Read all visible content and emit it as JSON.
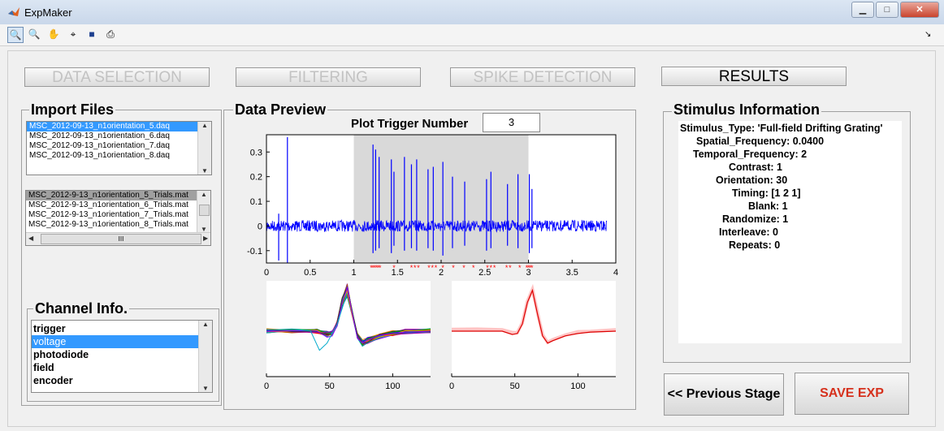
{
  "window": {
    "title": "ExpMaker",
    "minimize": "▁",
    "maximize": "□",
    "close": "✕"
  },
  "toolbar": {
    "icons": [
      "zoom-in-icon",
      "zoom-out-icon",
      "pan-icon",
      "data-cursor-icon",
      "save-icon",
      "print-icon"
    ],
    "corner": "↘"
  },
  "stages": {
    "data_selection": "DATA SELECTION",
    "filtering": "FILTERING",
    "spike_detection": "SPIKE DETECTION",
    "results": "RESULTS"
  },
  "import": {
    "title": "Import Files",
    "daq_files": [
      "MSC_2012-09-13_n1orientation_5.daq",
      "MSC_2012-09-13_n1orientation_6.daq",
      "MSC_2012-09-13_n1orientation_7.daq",
      "MSC_2012-09-13_n1orientation_8.daq"
    ],
    "trial_files": [
      "MSC_2012-9-13_n1orientation_5_Trials.mat",
      "MSC_2012-9-13_n1orientation_6_Trials.mat",
      "MSC_2012-9-13_n1orientation_7_Trials.mat",
      "MSC_2012-9-13_n1orientation_8_Trials.mat"
    ],
    "hscroll_thumb": "III"
  },
  "channel": {
    "title": "Channel Info.",
    "items": [
      "trigger",
      "voltage",
      "photodiode",
      "field",
      "encoder"
    ],
    "selected": "voltage"
  },
  "preview": {
    "title": "Data Preview",
    "trigger_label": "Plot Trigger Number",
    "trigger_value": "3"
  },
  "stimulus": {
    "title": "Stimulus Information",
    "lines": [
      "Stimulus_Type: 'Full-field Drifting Grating'",
      "Spatial_Frequency: 0.0400",
      "Temporal_Frequency: 2",
      "Contrast: 1",
      "Orientation: 30",
      "Timing: [1 2 1]",
      "Blank: 1",
      "Randomize: 1",
      "Interleave: 0",
      "Repeats: 0"
    ]
  },
  "buttons": {
    "previous": "<< Previous Stage",
    "save": "SAVE EXP"
  },
  "colors": {
    "trace": "#0000ff",
    "spike_marker": "#ff0000",
    "highlight": "#d9d9d9",
    "selection": "#3399ff",
    "save_text": "#d6301c"
  },
  "chart_data": [
    {
      "type": "line",
      "title": "",
      "xlim": [
        0,
        4
      ],
      "ylim": [
        -0.15,
        0.37
      ],
      "x_ticks": [
        "0",
        "0.5",
        "1",
        "1.5",
        "2",
        "2.5",
        "3",
        "3.5",
        "4"
      ],
      "y_ticks": [
        "0.3",
        "0.2",
        "0.1",
        "0",
        "-0.1"
      ],
      "highlight_range": [
        1,
        3
      ],
      "spikes": [
        {
          "x": 0.24,
          "y": 0.36,
          "ymin": -0.15
        },
        {
          "x": 0.14,
          "y": 0.05,
          "ymin": -0.14
        },
        {
          "x": 1.22,
          "y": 0.33,
          "ymin": -0.11
        },
        {
          "x": 1.25,
          "y": 0.31,
          "ymin": -0.1
        },
        {
          "x": 1.29,
          "y": 0.28,
          "ymin": -0.09
        },
        {
          "x": 1.43,
          "y": 0.27,
          "ymin": -0.11
        },
        {
          "x": 1.46,
          "y": 0.22,
          "ymin": -0.08
        },
        {
          "x": 1.58,
          "y": 0.28,
          "ymin": -0.1
        },
        {
          "x": 1.66,
          "y": 0.25,
          "ymin": -0.09
        },
        {
          "x": 1.72,
          "y": 0.27,
          "ymin": -0.1
        },
        {
          "x": 1.85,
          "y": 0.23,
          "ymin": -0.09
        },
        {
          "x": 1.91,
          "y": 0.24,
          "ymin": -0.1
        },
        {
          "x": 2.02,
          "y": 0.26,
          "ymin": -0.12
        },
        {
          "x": 2.13,
          "y": 0.2,
          "ymin": -0.09
        },
        {
          "x": 2.27,
          "y": 0.18,
          "ymin": -0.08
        },
        {
          "x": 2.52,
          "y": 0.19,
          "ymin": -0.1
        },
        {
          "x": 2.57,
          "y": 0.22,
          "ymin": -0.09
        },
        {
          "x": 2.76,
          "y": 0.17,
          "ymin": -0.08
        },
        {
          "x": 2.88,
          "y": 0.21,
          "ymin": -0.09
        },
        {
          "x": 3.01,
          "y": 0.21,
          "ymin": -0.11
        },
        {
          "x": 3.04,
          "y": 0.15,
          "ymin": -0.09
        }
      ],
      "spike_markers_x": [
        1.2,
        1.22,
        1.24,
        1.26,
        1.28,
        1.3,
        1.46,
        1.66,
        1.7,
        1.74,
        1.86,
        1.9,
        1.94,
        2.02,
        2.14,
        2.26,
        2.37,
        2.53,
        2.57,
        2.61,
        2.75,
        2.79,
        2.9,
        2.98,
        3.0,
        3.02,
        3.04
      ]
    },
    {
      "type": "line",
      "title": "",
      "xlim": [
        0,
        130
      ],
      "ylim": [
        -1,
        1
      ],
      "x_ticks": [
        "0",
        "50",
        "100"
      ],
      "description_series": "overlaid spike waveforms (multicolor)",
      "waveform": {
        "x": [
          0,
          20,
          40,
          48,
          52,
          56,
          60,
          64,
          68,
          72,
          76,
          80,
          90,
          100,
          110,
          130
        ],
        "y": [
          -0.05,
          -0.05,
          -0.05,
          -0.12,
          -0.1,
          0.1,
          0.55,
          0.8,
          0.3,
          -0.15,
          -0.3,
          -0.25,
          -0.15,
          -0.1,
          -0.07,
          -0.05
        ]
      }
    },
    {
      "type": "line",
      "title": "",
      "xlim": [
        0,
        130
      ],
      "ylim": [
        -1,
        1
      ],
      "x_ticks": [
        "0",
        "50",
        "100"
      ],
      "waveform": {
        "x": [
          0,
          20,
          40,
          48,
          52,
          56,
          60,
          64,
          68,
          72,
          76,
          80,
          90,
          100,
          110,
          130
        ],
        "y": [
          -0.05,
          -0.05,
          -0.05,
          -0.12,
          -0.1,
          0.1,
          0.55,
          0.8,
          0.3,
          -0.15,
          -0.3,
          -0.25,
          -0.15,
          -0.1,
          -0.07,
          -0.05
        ]
      }
    }
  ]
}
